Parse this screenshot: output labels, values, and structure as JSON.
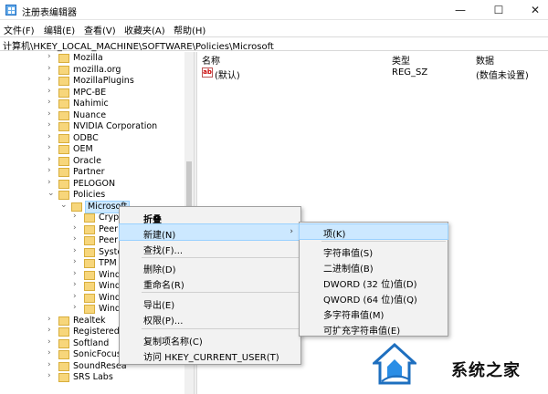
{
  "window": {
    "title": "注册表编辑器",
    "minimize": "—",
    "maximize": "☐",
    "close": "✕"
  },
  "menu": [
    "文件(F)",
    "编辑(E)",
    "查看(V)",
    "收藏夹(A)",
    "帮助(H)"
  ],
  "address": "计算机\\HKEY_LOCAL_MACHINE\\SOFTWARE\\Policies\\Microsoft",
  "tree": {
    "items_top": [
      "Mozilla",
      "mozilla.org",
      "MozillaPlugins",
      "MPC-BE",
      "Nahimic",
      "Nuance",
      "NVIDIA Corporation",
      "ODBC",
      "OEM",
      "Oracle",
      "Partner",
      "PELOGON"
    ],
    "policies": "Policies",
    "microsoft": "Microsoft",
    "children": [
      "Crypt",
      "Peer",
      "Peer",
      "Syste",
      "TPM",
      "Wind",
      "Wind",
      "Wind",
      "Wind"
    ],
    "items_bottom": [
      "Realtek",
      "RegisteredAp",
      "Softland",
      "SonicFocus",
      "SoundResea",
      "SRS Labs"
    ]
  },
  "list": {
    "headers": {
      "name": "名称",
      "type": "类型",
      "data": "数据"
    },
    "rows": [
      {
        "name": "(默认)",
        "type": "REG_SZ",
        "data": "(数值未设置)",
        "icon": "ab"
      }
    ]
  },
  "context_menu": {
    "collapse": "折叠",
    "new": "新建(N)",
    "find": "查找(F)...",
    "delete": "删除(D)",
    "rename": "重命名(R)",
    "export": "导出(E)",
    "permissions": "权限(P)...",
    "copy_key_name": "复制项名称(C)",
    "visit": "访问 HKEY_CURRENT_USER(T)"
  },
  "submenu": {
    "key": "项(K)",
    "string_value": "字符串值(S)",
    "binary_value": "二进制值(B)",
    "dword_value": "DWORD (32 位)值(D)",
    "qword_value": "QWORD (64 位)值(Q)",
    "multi_string": "多字符串值(M)",
    "expandable_string": "可扩充字符串值(E)"
  },
  "watermark": {
    "text": "系统之家"
  },
  "colors": {
    "highlight": "#cce8ff",
    "highlight_border": "#99d1ff",
    "folder": "#f7d67b"
  }
}
